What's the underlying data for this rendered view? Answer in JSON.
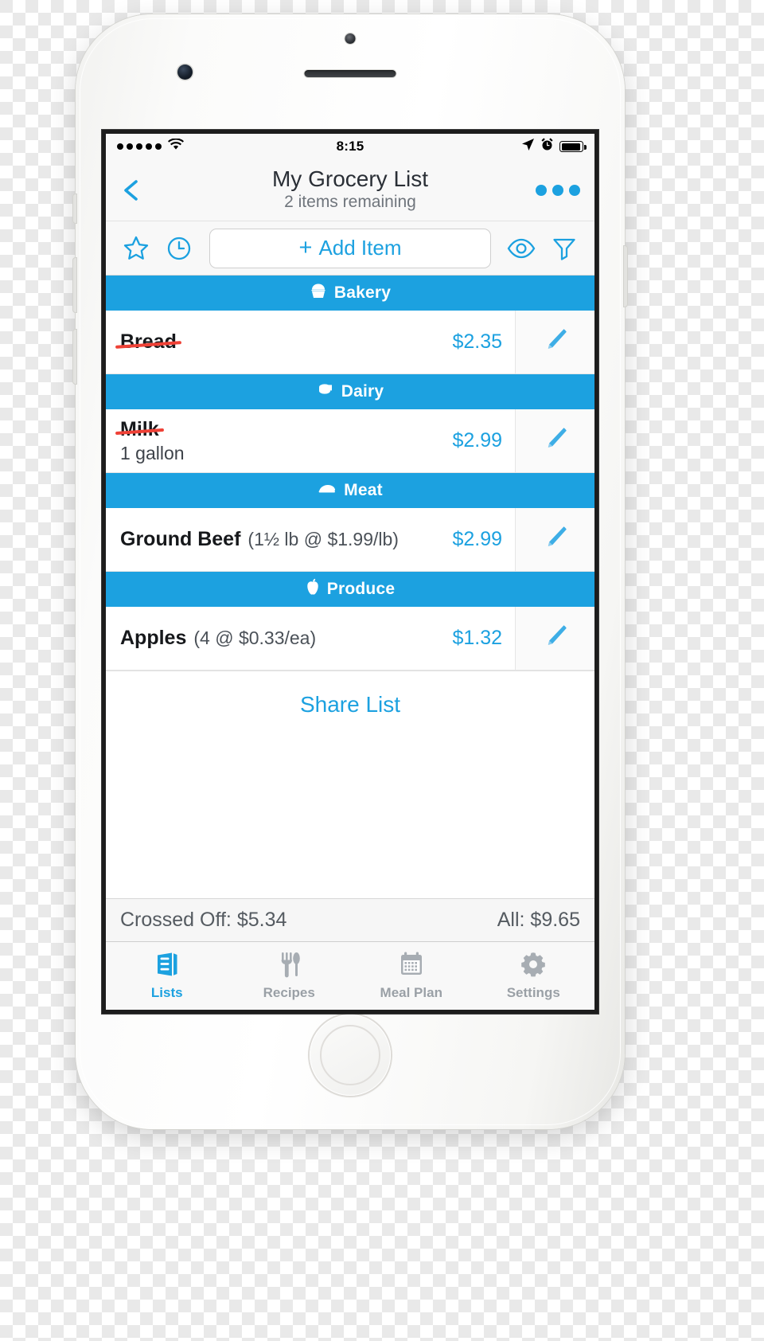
{
  "colors": {
    "accent": "#1ca1e0",
    "crossed": "#ef4136",
    "muted": "#9aa0a6"
  },
  "status_bar": {
    "signal_icon": "signal-dots-icon",
    "wifi_icon": "wifi-icon",
    "time": "8:15",
    "location_icon": "location-arrow-icon",
    "alarm_icon": "alarm-clock-icon",
    "battery_icon": "battery-icon"
  },
  "nav": {
    "back_icon": "back-chevron-icon",
    "title": "My Grocery List",
    "subtitle": "2 items remaining",
    "more_icon": "more-options-icon"
  },
  "toolbar": {
    "favorite_icon": "star-icon",
    "history_icon": "clock-icon",
    "add_plus": "+",
    "add_label": "Add Item",
    "view_icon": "eye-icon",
    "filter_icon": "funnel-filter-icon"
  },
  "sections": [
    {
      "name": "Bakery",
      "icon": "cupcake-icon",
      "items": [
        {
          "name": "Bread",
          "qty": "",
          "sub": "",
          "price": "$2.35",
          "crossed": true,
          "edit_icon": "pencil-edit-icon"
        }
      ]
    },
    {
      "name": "Dairy",
      "icon": "milk-carton-icon",
      "items": [
        {
          "name": "Milk",
          "qty": "",
          "sub": "1 gallon",
          "price": "$2.99",
          "crossed": true,
          "edit_icon": "pencil-edit-icon"
        }
      ]
    },
    {
      "name": "Meat",
      "icon": "meat-icon",
      "items": [
        {
          "name": "Ground Beef",
          "qty": "(1½ lb @ $1.99/lb)",
          "sub": "",
          "price": "$2.99",
          "crossed": false,
          "edit_icon": "pencil-edit-icon"
        }
      ]
    },
    {
      "name": "Produce",
      "icon": "apple-icon",
      "items": [
        {
          "name": "Apples",
          "qty": "(4 @ $0.33/ea)",
          "sub": "",
          "price": "$1.32",
          "crossed": false,
          "edit_icon": "pencil-edit-icon"
        }
      ]
    }
  ],
  "share": {
    "label": "Share List"
  },
  "totals": {
    "crossed_off": "Crossed Off: $5.34",
    "all": "All: $9.65"
  },
  "tabs": [
    {
      "label": "Lists",
      "icon": "lists-icon",
      "active": true
    },
    {
      "label": "Recipes",
      "icon": "utensils-icon",
      "active": false
    },
    {
      "label": "Meal Plan",
      "icon": "calendar-icon",
      "active": false
    },
    {
      "label": "Settings",
      "icon": "gear-icon",
      "active": false
    }
  ]
}
